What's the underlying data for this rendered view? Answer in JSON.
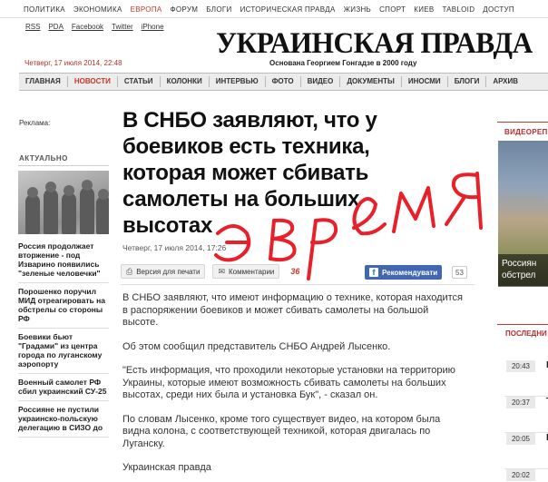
{
  "topnav": [
    "ПОЛИТИКА",
    "ЭКОНОМИКА",
    "ЕВРОПА",
    "ФОРУМ",
    "БЛОГИ",
    "ИСТОРИЧЕСКАЯ ПРАВДА",
    "ЖИЗНЬ",
    "СПОРТ",
    "КИЕВ",
    "TABLOID",
    "ДОСТУП"
  ],
  "topnav_active": 2,
  "util_links": [
    "RSS",
    "PDA",
    "Facebook",
    "Twitter",
    "iPhone"
  ],
  "masthead": {
    "title": "УКРАИНСКАЯ ПРАВДА",
    "tagline": "Основана Георгием Гонгадзе в 2000 году",
    "datestamp": "Четверг, 17 июля 2014, 22:48"
  },
  "main_menu": [
    "ГЛАВНАЯ",
    "НОВОСТИ",
    "СТАТЬИ",
    "КОЛОНКИ",
    "ИНТЕРВЬЮ",
    "ФОТО",
    "ВИДЕО",
    "ДОКУМЕНТЫ",
    "ИНОСМИ",
    "БЛОГИ",
    "АРХИВ"
  ],
  "main_menu_active": 1,
  "sidebar": {
    "ad_label": "Реклама:",
    "section_title": "АКТУАЛЬНО",
    "news": [
      "Россия продолжает вторжение - под Изварино появились \"зеленые человечки\"",
      "Порошенко поручил МИД отреагировать на обстрелы со стороны РФ",
      "Боевики бьют \"Градами\" из центра города по луганскому аэропорту",
      "Военный самолет РФ сбил украинский СУ-25",
      "Россияне не пустили украинско-польскую делегацию в СИЗО до"
    ]
  },
  "article": {
    "headline": "В СНБО заявляют, что у боевиков есть техника, которая может сбивать самолеты на больших высотах",
    "date": "Четверг, 17 июля 2014, 17:26",
    "print_label": "Версия для печати",
    "comments_label": "Комментарии",
    "comments_count": "36",
    "fb_label": "Рекомендувати",
    "fb_count": "53",
    "paragraphs": [
      "В СНБО заявляют, что имеют информацию о технике, которая находится в распоряжении боевиков и может сбивать самолеты на большой высоте.",
      "Об этом сообщил представитель СНБО Андрей Лысенко.",
      "\"Есть информация, что проходили некоторые установки на территорию Украины, которые имеют возможность сбивать самолеты на больших высотах, среди них была и установка Бук\", - сказал он.",
      "По словам Лысенко, кроме того существует видео, на котором была видна колона, с соответствующей техникой, которая двигалась по Луганску.",
      "Украинская правда"
    ]
  },
  "right_column": {
    "video_label": "ВИДЕОРЕП",
    "video_caption": [
      "Россиян",
      "обстрел"
    ],
    "latest_label": "ПОСЛЕДНИ",
    "latest": [
      {
        "time": "20:43",
        "letter": "В"
      },
      {
        "time": "20:37",
        "letter": "Т"
      },
      {
        "time": "20:05",
        "letter": "П"
      },
      {
        "time": "20:02",
        "letter": ""
      }
    ]
  },
  "annotation": {
    "handwritten": "э время",
    "color": "#e8202a"
  },
  "colors": {
    "accent_red": "#c0392b",
    "facebook_blue": "#4267b2"
  }
}
